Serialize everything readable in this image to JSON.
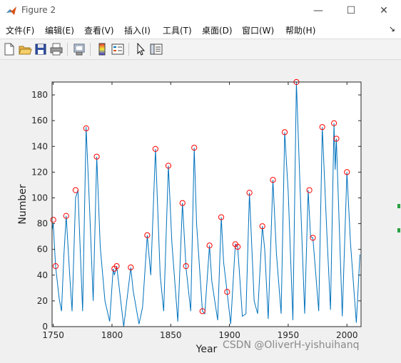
{
  "window": {
    "title": "Figure 2",
    "minimize_icon": "minimize-icon",
    "maximize_icon": "maximize-icon",
    "close_icon": "close-icon"
  },
  "menubar": {
    "items": [
      "文件(F)",
      "编辑(E)",
      "查看(V)",
      "插入(I)",
      "工具(T)",
      "桌面(D)",
      "窗口(W)",
      "帮助(H)"
    ],
    "overflow_icon": "dock-arrow-icon"
  },
  "toolbar": {
    "icons": [
      "new-figure-icon",
      "open-file-icon",
      "save-icon",
      "print-icon",
      "print-preview-icon",
      "colorbar-icon",
      "legend-icon",
      "pointer-icon",
      "property-inspector-icon"
    ]
  },
  "chart_data": {
    "type": "line",
    "title": "",
    "xlabel": "Year",
    "ylabel": "Number",
    "xlim": [
      1749,
      2012
    ],
    "ylim": [
      0,
      190
    ],
    "xticks": [
      1750,
      1800,
      1850,
      1900,
      1950,
      2000
    ],
    "yticks": [
      0,
      20,
      40,
      60,
      80,
      100,
      120,
      140,
      160,
      180
    ],
    "grid": false,
    "line_color": "#0072bd",
    "marker_color": "#ff0000",
    "series": [
      {
        "x": [
          1749,
          1750,
          1752,
          1755,
          1757,
          1759,
          1761,
          1764,
          1766,
          1769,
          1771,
          1775,
          1778,
          1781,
          1784,
          1787,
          1790,
          1794,
          1798,
          1801,
          1802,
          1804,
          1810,
          1816,
          1818,
          1823,
          1826,
          1830,
          1833,
          1837,
          1841,
          1844,
          1848,
          1851,
          1856,
          1860,
          1863,
          1867,
          1870,
          1872,
          1877,
          1879,
          1883,
          1885,
          1890,
          1893,
          1895,
          1898,
          1901,
          1905,
          1907,
          1911,
          1914,
          1917,
          1921,
          1924,
          1928,
          1930,
          1933,
          1937,
          1940,
          1944,
          1947,
          1950,
          1954,
          1957,
          1960,
          1964,
          1967,
          1969,
          1971,
          1976,
          1979,
          1983,
          1986,
          1989,
          1990,
          1991,
          1996,
          2000,
          2003,
          2008,
          2011
        ],
        "y": [
          75,
          80,
          47,
          22,
          12,
          55,
          86,
          40,
          12,
          100,
          106,
          12,
          155,
          90,
          20,
          132,
          62,
          20,
          4,
          45,
          40,
          47,
          0,
          46,
          28,
          2,
          15,
          71,
          40,
          138,
          40,
          12,
          125,
          65,
          4,
          96,
          46,
          12,
          139,
          80,
          12,
          10,
          63,
          35,
          5,
          85,
          50,
          27,
          2,
          64,
          62,
          8,
          10,
          104,
          20,
          10,
          78,
          60,
          6,
          114,
          56,
          10,
          151,
          105,
          5,
          190,
          110,
          10,
          106,
          70,
          69,
          12,
          155,
          70,
          13,
          158,
          122,
          146,
          8,
          120,
          65,
          3,
          56
        ]
      }
    ],
    "markers": [
      {
        "x": 1750,
        "y": 83
      },
      {
        "x": 1752,
        "y": 47
      },
      {
        "x": 1761,
        "y": 86
      },
      {
        "x": 1769,
        "y": 106
      },
      {
        "x": 1778,
        "y": 154
      },
      {
        "x": 1787,
        "y": 132
      },
      {
        "x": 1802,
        "y": 45
      },
      {
        "x": 1804,
        "y": 47
      },
      {
        "x": 1816,
        "y": 46
      },
      {
        "x": 1830,
        "y": 71
      },
      {
        "x": 1837,
        "y": 138
      },
      {
        "x": 1848,
        "y": 125
      },
      {
        "x": 1860,
        "y": 96
      },
      {
        "x": 1863,
        "y": 47
      },
      {
        "x": 1870,
        "y": 139
      },
      {
        "x": 1877,
        "y": 12
      },
      {
        "x": 1883,
        "y": 63
      },
      {
        "x": 1893,
        "y": 85
      },
      {
        "x": 1898,
        "y": 27
      },
      {
        "x": 1905,
        "y": 64
      },
      {
        "x": 1907,
        "y": 62
      },
      {
        "x": 1917,
        "y": 104
      },
      {
        "x": 1928,
        "y": 78
      },
      {
        "x": 1937,
        "y": 114
      },
      {
        "x": 1947,
        "y": 151
      },
      {
        "x": 1957,
        "y": 190
      },
      {
        "x": 1968,
        "y": 106
      },
      {
        "x": 1971,
        "y": 69
      },
      {
        "x": 1979,
        "y": 155
      },
      {
        "x": 1989,
        "y": 158
      },
      {
        "x": 1991,
        "y": 146
      },
      {
        "x": 2000,
        "y": 120
      }
    ]
  },
  "watermark": "CSDN @OliverH-yishuihanq"
}
